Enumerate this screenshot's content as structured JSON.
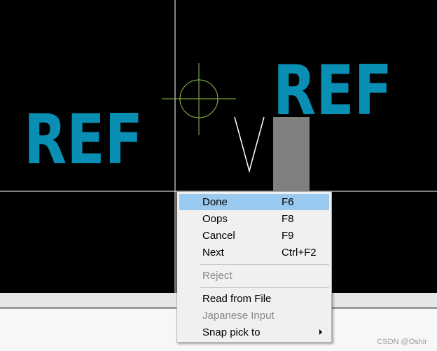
{
  "canvas": {
    "ref_text_left": "REF",
    "ref_text_right": "REF",
    "ref_color": "#0a8fb4",
    "crosshair_color": "#8bc34a",
    "component_body_color": "#808080"
  },
  "menu": {
    "items": [
      {
        "label": "Done",
        "shortcut": "F6",
        "highlighted": true,
        "disabled": false
      },
      {
        "label": "Oops",
        "shortcut": "F8",
        "highlighted": false,
        "disabled": false
      },
      {
        "label": "Cancel",
        "shortcut": "F9",
        "highlighted": false,
        "disabled": false
      },
      {
        "label": "Next",
        "shortcut": "Ctrl+F2",
        "highlighted": false,
        "disabled": false
      },
      {
        "label": "Reject",
        "shortcut": "",
        "highlighted": false,
        "disabled": true
      },
      {
        "label": "Read from File",
        "shortcut": "",
        "highlighted": false,
        "disabled": false
      },
      {
        "label": "Japanese Input",
        "shortcut": "",
        "highlighted": false,
        "disabled": true
      },
      {
        "label": "Snap pick to",
        "shortcut": "",
        "highlighted": false,
        "disabled": false,
        "has_submenu": true
      }
    ]
  },
  "watermark": "CSDN @Oshir"
}
